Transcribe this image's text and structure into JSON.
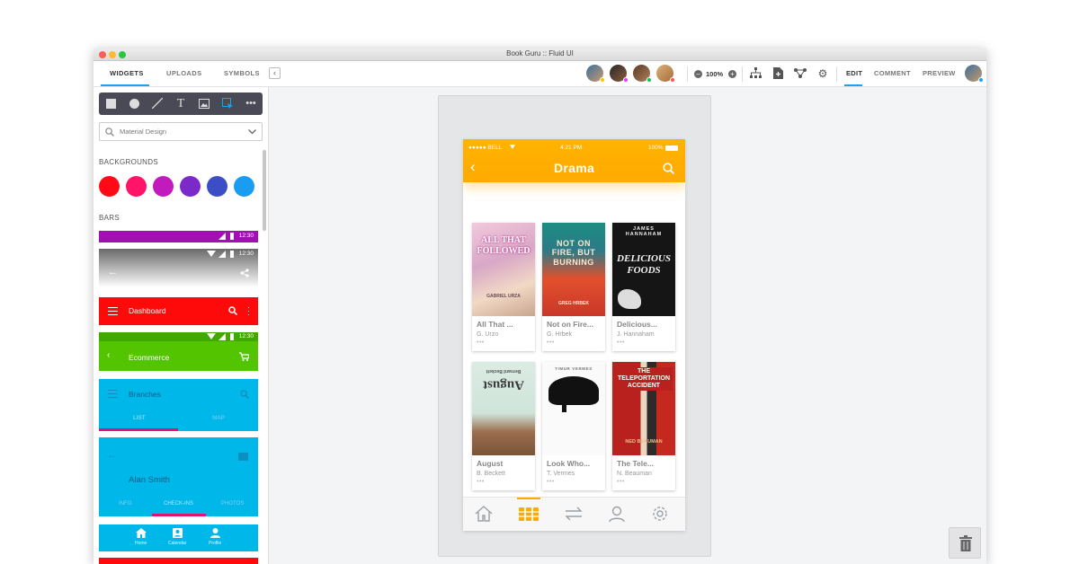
{
  "window": {
    "title": "Book Guru :: Fluid UI"
  },
  "panel_tabs": [
    {
      "label": "WIDGETS"
    },
    {
      "label": "UPLOADS"
    },
    {
      "label": "SYMBOLS"
    }
  ],
  "toolbar": {
    "zoom": "100%",
    "modes": [
      {
        "label": "EDIT"
      },
      {
        "label": "COMMENT"
      },
      {
        "label": "PREVIEW"
      }
    ]
  },
  "sidebar": {
    "search": {
      "value": "Material Design"
    },
    "backgrounds_label": "BACKGROUNDS",
    "bars_label": "BARS",
    "swatch_colors": [
      "#ff0a16",
      "#ff1469",
      "#c21bbd",
      "#7b2ac9",
      "#3b4ec4",
      "#1a9cf2"
    ],
    "bars": {
      "purple_time": "12:30",
      "gray_time": "12:30",
      "dashboard": "Dashboard",
      "green_time": "12:30",
      "ecommerce": "Ecommerce",
      "branches": "Branches",
      "list_tab": "LIST",
      "map_tab": "MAP",
      "profile_name": "Alan Smith",
      "info_tab": "INFO",
      "checkins_tab": "CHECK-INS",
      "photos_tab": "PHOTOS",
      "nav_home": "Home",
      "nav_calendar": "Calendar",
      "nav_profile": "Profile"
    }
  },
  "phone": {
    "carrier": "●●●●● BELL",
    "time": "4:21 PM",
    "battery": "100%",
    "title": "Drama",
    "books": [
      {
        "title": "All That ...",
        "author": "G. Urzo",
        "cover_text": "ALL THAT FOLLOWED",
        "cover_sub": "GABRIEL URZA"
      },
      {
        "title": "Not on Fire...",
        "author": "G. Hrbek",
        "cover_text": "NOT ON FIRE, BUT BURNING",
        "cover_sub": "GREG HRBEK"
      },
      {
        "title": "Delicious...",
        "author": "J. Hannaham",
        "cover_text": "DELICIOUS FOODS",
        "cover_sub": "JAMES HANNAHAM"
      },
      {
        "title": "August",
        "author": "B. Beckett",
        "cover_text": "August",
        "cover_sub": "Bernard Beckett"
      },
      {
        "title": "Look Who...",
        "author": "T. Vermes",
        "cover_text": "",
        "cover_sub": "TIMUR VERMES"
      },
      {
        "title": "The Tele...",
        "author": "N. Beauman",
        "cover_text": "THE TELEPORTATION ACCIDENT",
        "cover_sub": "NED BEAUMAN"
      }
    ]
  },
  "colors": {
    "accent": "#1da1f2",
    "appbar": "#ffaa00"
  }
}
